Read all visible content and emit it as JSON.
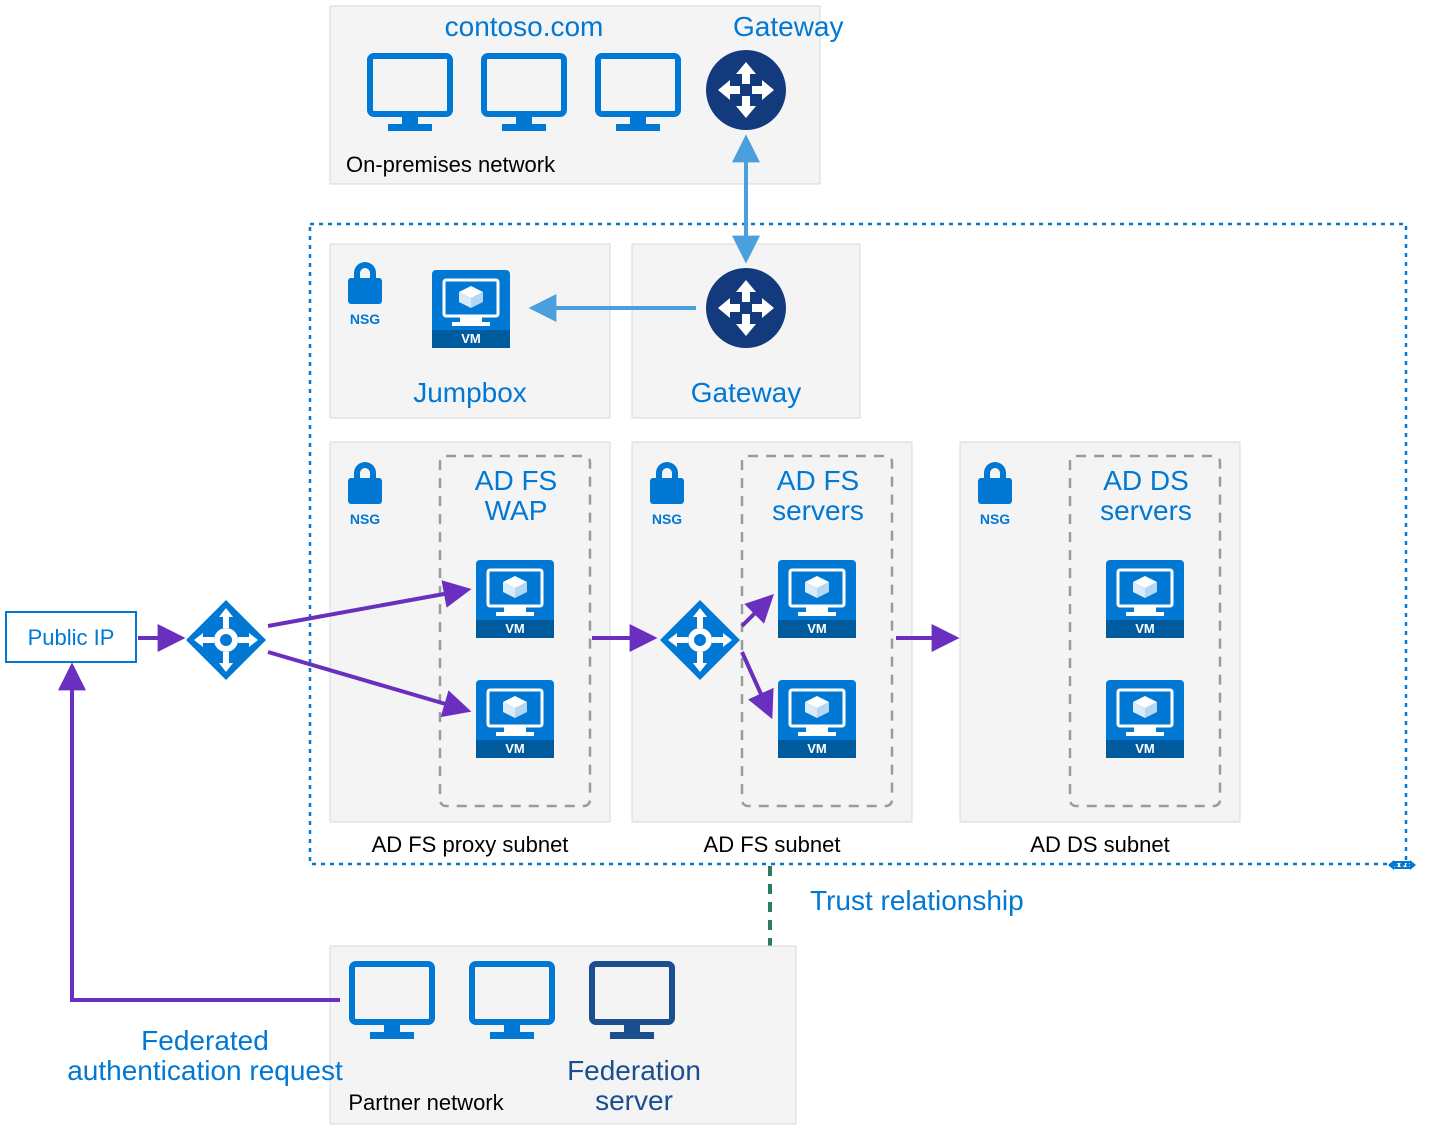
{
  "onprem": {
    "title": "contoso.com",
    "gateway": "Gateway",
    "caption": "On-premises network"
  },
  "azure": {
    "jumpbox": {
      "nsg": "NSG",
      "label": "Jumpbox"
    },
    "gateway": {
      "label": "Gateway"
    },
    "adfs_proxy": {
      "nsg": "NSG",
      "title1": "AD FS",
      "title2": "WAP",
      "caption": "AD FS proxy subnet"
    },
    "adfs": {
      "nsg": "NSG",
      "title1": "AD FS",
      "title2": "servers",
      "caption": "AD FS subnet"
    },
    "adds": {
      "nsg": "NSG",
      "title1": "AD DS",
      "title2": "servers",
      "caption": "AD DS subnet"
    }
  },
  "publicip": "Public IP",
  "trust": "Trust relationship",
  "federated1": "Federated",
  "federated2": "authentication request",
  "partner": {
    "caption": "Partner network",
    "server1": "Federation",
    "server2": "server"
  },
  "vm": "VM"
}
